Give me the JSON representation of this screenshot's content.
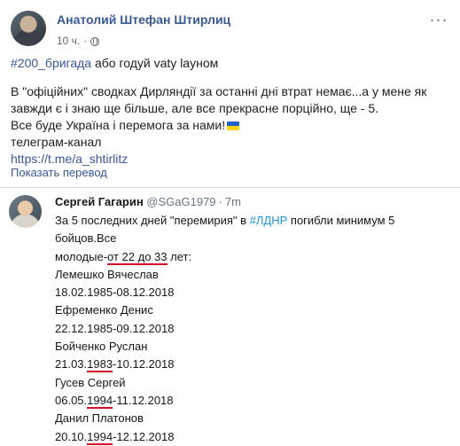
{
  "post": {
    "author": "Анатолий Штефан Штирлиц",
    "time": "10 ч.",
    "separator": "·",
    "more_label": "···",
    "hashtag": "#200_бригада",
    "hashtag_rest": " або годуй vaty layном",
    "para1": "В \"офіційних\" сводках Дирляндії за останні дні втрат немає...а у мене як завжди є і знаю ще більше, але все прекрасне порційно, ще - 5.",
    "para2": "Все буде Україна і перемога за нами!",
    "para3": "телеграм-канал",
    "link": "https://t.me/a_shtirlitz",
    "translate": "Показать перевод"
  },
  "tweet": {
    "name": "Сергей Гагарин",
    "handle": "@SGaG1979",
    "dot": "·",
    "time": "7m",
    "line1_a": "За 5 последних дней \"перемирия\" в ",
    "line1_tag": "#ЛДНР",
    "line1_b": " погибли минимум 5 бойцов.Все",
    "line2_a": "молодые-",
    "line2_ul": "от 22 до 33",
    "line2_b": " лет:",
    "entries": [
      {
        "name": "Лемешко Вячеслав",
        "d_pre": "18.02.1985-08.12.2018",
        "d_ul": "",
        "d_post": ""
      },
      {
        "name": "Ефременко Денис",
        "d_pre": "22.12.1985-09.12.2018",
        "d_ul": "",
        "d_post": ""
      },
      {
        "name": "Бойченко Руслан",
        "d_pre": "21.03.",
        "d_ul": "1983",
        "d_post": "-10.12.2018"
      },
      {
        "name": "Гусев Сергей",
        "d_pre": "06.05.",
        "d_ul": "1994",
        "d_post": "-11.12.2018"
      },
      {
        "name": "Данил Платонов",
        "d_pre": "20.10.",
        "d_ul": "1994",
        "d_post": "-12.12.2018"
      }
    ]
  },
  "colors": {
    "link": "#385898",
    "tweet_tag": "#1b95e0",
    "underline": "#d3102a"
  }
}
